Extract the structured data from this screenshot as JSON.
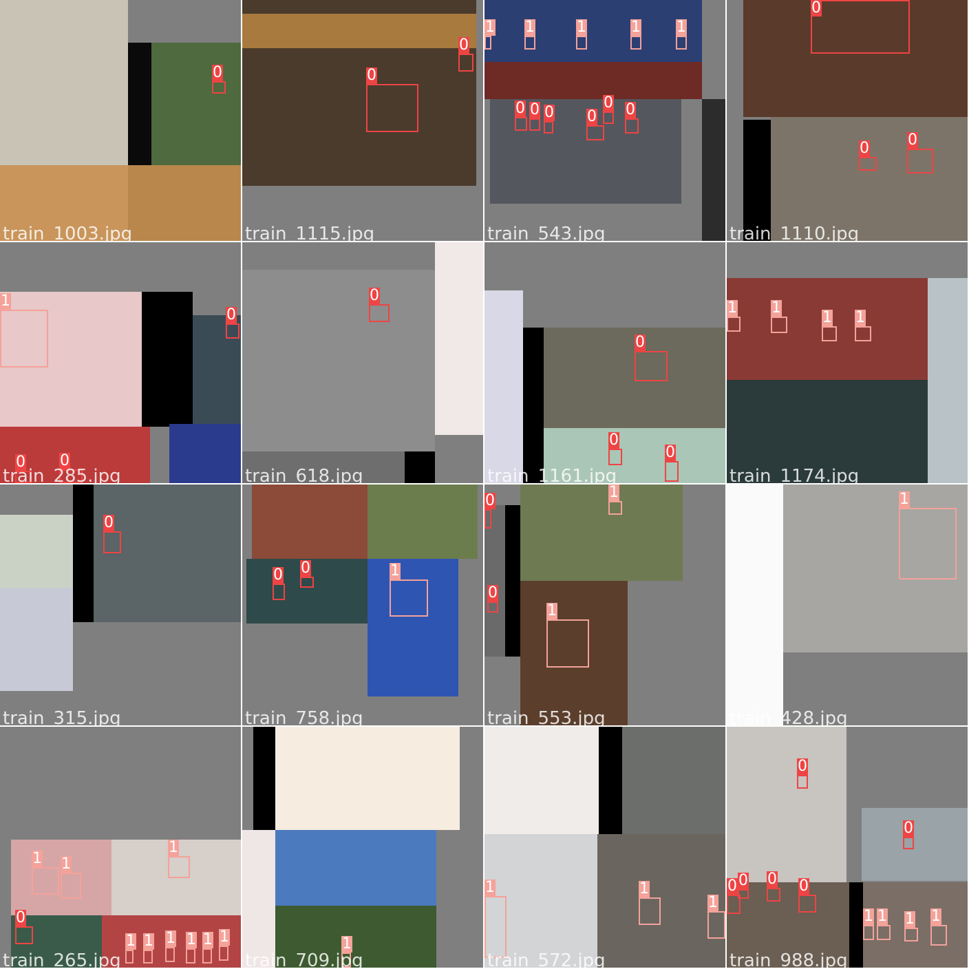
{
  "colors": {
    "class_0": "#ee4444",
    "class_1": "#f4a29a",
    "background": "#7f7f7f",
    "separator": "#ffffff"
  },
  "tiles": [
    {
      "filename": "train_1003.jpg",
      "photos": [
        {
          "r": [
            0,
            0,
            186,
            240
          ],
          "c": "#c9c3b6"
        },
        {
          "r": [
            186,
            62,
            164,
            180
          ],
          "c": "#0a0a0a"
        },
        {
          "r": [
            220,
            62,
            130,
            178
          ],
          "c": "#4e6a3e"
        },
        {
          "r": [
            0,
            240,
            186,
            110
          ],
          "c": "#c9955a"
        },
        {
          "r": [
            186,
            240,
            164,
            110
          ],
          "c": "#b9874c"
        }
      ],
      "boxes": [
        {
          "r": [
            308,
            118,
            20,
            18
          ],
          "cls": "0"
        }
      ]
    },
    {
      "filename": "train_1115.jpg",
      "photos": [
        {
          "r": [
            0,
            0,
            340,
            270
          ],
          "c": "#4a3b2c"
        },
        {
          "r": [
            0,
            20,
            340,
            50
          ],
          "c": "#a97a3e"
        }
      ],
      "boxes": [
        {
          "r": [
            180,
            122,
            76,
            70
          ],
          "cls": "0"
        },
        {
          "r": [
            314,
            78,
            22,
            26
          ],
          "cls": "0"
        }
      ]
    },
    {
      "filename": "train_543.jpg",
      "photos": [
        {
          "r": [
            0,
            0,
            316,
            144
          ],
          "c": "#2c3f73"
        },
        {
          "r": [
            0,
            90,
            316,
            54
          ],
          "c": "#6e2a25"
        },
        {
          "r": [
            8,
            144,
            278,
            152
          ],
          "c": "#55575e"
        },
        {
          "r": [
            316,
            144,
            34,
            206
          ],
          "c": "#2c2c2c"
        }
      ],
      "boxes": [
        {
          "r": [
            0,
            52,
            10,
            20
          ],
          "cls": "1"
        },
        {
          "r": [
            58,
            52,
            16,
            20
          ],
          "cls": "1"
        },
        {
          "r": [
            133,
            52,
            16,
            20
          ],
          "cls": "1"
        },
        {
          "r": [
            212,
            52,
            16,
            20
          ],
          "cls": "1"
        },
        {
          "r": [
            278,
            52,
            16,
            20
          ],
          "cls": "1"
        },
        {
          "r": [
            44,
            170,
            18,
            20
          ],
          "cls": "0"
        },
        {
          "r": [
            65,
            172,
            16,
            18
          ],
          "cls": "0"
        },
        {
          "r": [
            86,
            176,
            14,
            18
          ],
          "cls": "0"
        },
        {
          "r": [
            148,
            182,
            26,
            22
          ],
          "cls": "0"
        },
        {
          "r": [
            172,
            162,
            16,
            18
          ],
          "cls": "0"
        },
        {
          "r": [
            204,
            172,
            20,
            22
          ],
          "cls": "0"
        }
      ]
    },
    {
      "filename": "train_1110.jpg",
      "photos": [
        {
          "r": [
            24,
            0,
            326,
            170
          ],
          "c": "#5a3a2a"
        },
        {
          "r": [
            64,
            170,
            286,
            180
          ],
          "c": "#7c7468"
        },
        {
          "r": [
            24,
            174,
            40,
            176
          ],
          "c": "#000000"
        }
      ],
      "boxes": [
        {
          "r": [
            122,
            0,
            144,
            78
          ],
          "cls": "0"
        },
        {
          "r": [
            192,
            228,
            26,
            20
          ],
          "cls": "0"
        },
        {
          "r": [
            262,
            216,
            38,
            36
          ],
          "cls": "0"
        }
      ]
    },
    {
      "filename": "train_285.jpg",
      "photos": [
        {
          "r": [
            0,
            72,
            206,
            196
          ],
          "c": "#e8c8c8"
        },
        {
          "r": [
            206,
            72,
            74,
            196
          ],
          "c": "#000000"
        },
        {
          "r": [
            280,
            106,
            70,
            164
          ],
          "c": "#3b4b56"
        },
        {
          "r": [
            0,
            268,
            218,
            82
          ],
          "c": "#bb3a3a"
        },
        {
          "r": [
            246,
            264,
            104,
            86
          ],
          "c": "#2a3b8e"
        }
      ],
      "boxes": [
        {
          "r": [
            0,
            98,
            70,
            84
          ],
          "cls": "1"
        },
        {
          "r": [
            328,
            118,
            20,
            22
          ],
          "cls": "0"
        },
        {
          "r": [
            22,
            332,
            24,
            18
          ],
          "cls": "0"
        },
        {
          "r": [
            86,
            330,
            34,
            20
          ],
          "cls": "0"
        }
      ]
    },
    {
      "filename": "train_618.jpg",
      "photos": [
        {
          "r": [
            0,
            40,
            280,
            264
          ],
          "c": "#8d8d8d"
        },
        {
          "r": [
            280,
            0,
            70,
            280
          ],
          "c": "#f1e8e8"
        },
        {
          "r": [
            0,
            304,
            280,
            46
          ],
          "c": "#6e6e6e"
        },
        {
          "r": [
            236,
            304,
            44,
            46
          ],
          "c": "#000000"
        }
      ],
      "boxes": [
        {
          "r": [
            184,
            90,
            30,
            26
          ],
          "cls": "0"
        }
      ]
    },
    {
      "filename": "train_1161.jpg",
      "photos": [
        {
          "r": [
            0,
            70,
            56,
            280
          ],
          "c": "#d8d8e6"
        },
        {
          "r": [
            56,
            124,
            30,
            226
          ],
          "c": "#000000"
        },
        {
          "r": [
            86,
            124,
            264,
            146
          ],
          "c": "#6c6a5c"
        },
        {
          "r": [
            86,
            270,
            264,
            80
          ],
          "c": "#aac6b6"
        }
      ],
      "boxes": [
        {
          "r": [
            218,
            158,
            48,
            44
          ],
          "cls": "0"
        },
        {
          "r": [
            180,
            300,
            20,
            24
          ],
          "cls": "0"
        },
        {
          "r": [
            262,
            318,
            20,
            30
          ],
          "cls": "0"
        }
      ]
    },
    {
      "filename": "train_1174.jpg",
      "photos": [
        {
          "r": [
            0,
            52,
            350,
            298
          ],
          "c": "#8a3a35"
        },
        {
          "r": [
            0,
            200,
            350,
            150
          ],
          "c": "#2b3a3b"
        },
        {
          "r": [
            292,
            52,
            58,
            298
          ],
          "c": "#b9c2c6"
        }
      ],
      "boxes": [
        {
          "r": [
            0,
            108,
            20,
            22
          ],
          "cls": "1"
        },
        {
          "r": [
            64,
            108,
            24,
            24
          ],
          "cls": "1"
        },
        {
          "r": [
            138,
            122,
            22,
            22
          ],
          "cls": "1"
        },
        {
          "r": [
            186,
            122,
            24,
            22
          ],
          "cls": "1"
        }
      ]
    },
    {
      "filename": "train_315.jpg",
      "photos": [
        {
          "r": [
            0,
            44,
            106,
            256
          ],
          "c": "#c9d2c4"
        },
        {
          "r": [
            106,
            0,
            30,
            200
          ],
          "c": "#000000"
        },
        {
          "r": [
            136,
            0,
            214,
            200
          ],
          "c": "#5b6466"
        },
        {
          "r": [
            0,
            150,
            106,
            150
          ],
          "c": "#c7c9d6"
        }
      ],
      "boxes": [
        {
          "r": [
            150,
            68,
            26,
            32
          ],
          "cls": "0"
        }
      ]
    },
    {
      "filename": "train_758.jpg",
      "photos": [
        {
          "r": [
            14,
            0,
            168,
            108
          ],
          "c": "#8c4a38"
        },
        {
          "r": [
            182,
            0,
            160,
            108
          ],
          "c": "#6b7d4c"
        },
        {
          "r": [
            6,
            108,
            176,
            94
          ],
          "c": "#2f4a4a"
        },
        {
          "r": [
            182,
            108,
            132,
            200
          ],
          "c": "#2f55b2"
        }
      ],
      "boxes": [
        {
          "r": [
            44,
            144,
            18,
            24
          ],
          "cls": "0"
        },
        {
          "r": [
            84,
            134,
            20,
            16
          ],
          "cls": "0"
        },
        {
          "r": [
            214,
            138,
            56,
            54
          ],
          "cls": "1"
        }
      ]
    },
    {
      "filename": "train_553.jpg",
      "photos": [
        {
          "r": [
            0,
            30,
            30,
            220
          ],
          "c": "#6a6a6a"
        },
        {
          "r": [
            30,
            30,
            22,
            220
          ],
          "c": "#000000"
        },
        {
          "r": [
            52,
            0,
            236,
            140
          ],
          "c": "#6e7a52"
        },
        {
          "r": [
            52,
            140,
            156,
            210
          ],
          "c": "#5b3e2c"
        }
      ],
      "boxes": [
        {
          "r": [
            0,
            36,
            10,
            28
          ],
          "cls": "0"
        },
        {
          "r": [
            4,
            170,
            16,
            16
          ],
          "cls": "0"
        },
        {
          "r": [
            180,
            24,
            20,
            20
          ],
          "cls": "1"
        },
        {
          "r": [
            90,
            196,
            62,
            70
          ],
          "cls": "1"
        }
      ]
    },
    {
      "filename": "train_428.jpg",
      "photos": [
        {
          "r": [
            0,
            0,
            82,
            350
          ],
          "c": "#fafafa"
        },
        {
          "r": [
            82,
            0,
            268,
            244
          ],
          "c": "#a7a6a2"
        }
      ],
      "boxes": [
        {
          "r": [
            250,
            34,
            84,
            104
          ],
          "cls": "1"
        }
      ]
    },
    {
      "filename": "train_265.jpg",
      "photos": [
        {
          "r": [
            16,
            164,
            146,
            110
          ],
          "c": "#d6a6a6"
        },
        {
          "r": [
            162,
            164,
            188,
            110
          ],
          "c": "#d7cfc9"
        },
        {
          "r": [
            16,
            274,
            132,
            76
          ],
          "c": "#3a5a4a"
        },
        {
          "r": [
            148,
            274,
            202,
            76
          ],
          "c": "#b24444"
        }
      ],
      "boxes": [
        {
          "r": [
            46,
            204,
            40,
            40
          ],
          "cls": "1"
        },
        {
          "r": [
            88,
            212,
            30,
            38
          ],
          "cls": "1"
        },
        {
          "r": [
            244,
            188,
            32,
            32
          ],
          "cls": "1"
        },
        {
          "r": [
            22,
            290,
            26,
            26
          ],
          "cls": "0"
        },
        {
          "r": [
            182,
            324,
            12,
            20
          ],
          "cls": "1"
        },
        {
          "r": [
            208,
            324,
            14,
            20
          ],
          "cls": "1"
        },
        {
          "r": [
            240,
            320,
            14,
            22
          ],
          "cls": "1"
        },
        {
          "r": [
            270,
            322,
            14,
            22
          ],
          "cls": "1"
        },
        {
          "r": [
            294,
            322,
            14,
            22
          ],
          "cls": "1"
        },
        {
          "r": [
            318,
            318,
            14,
            22
          ],
          "cls": "1"
        }
      ]
    },
    {
      "filename": "train_709.jpg",
      "photos": [
        {
          "r": [
            16,
            0,
            32,
            150
          ],
          "c": "#000000"
        },
        {
          "r": [
            48,
            0,
            268,
            150
          ],
          "c": "#f6ecdf"
        },
        {
          "r": [
            0,
            150,
            48,
            200
          ],
          "c": "#efe6e6"
        },
        {
          "r": [
            48,
            150,
            234,
            200
          ],
          "c": "#4b7abf"
        },
        {
          "r": [
            48,
            260,
            234,
            90
          ],
          "c": "#3d5a30"
        }
      ],
      "boxes": [
        {
          "r": [
            144,
            328,
            14,
            22
          ],
          "cls": "1"
        }
      ]
    },
    {
      "filename": "train_572.jpg",
      "photos": [
        {
          "r": [
            0,
            0,
            166,
            156
          ],
          "c": "#f0ecea"
        },
        {
          "r": [
            166,
            0,
            34,
            156
          ],
          "c": "#000000"
        },
        {
          "r": [
            200,
            0,
            150,
            156
          ],
          "c": "#6b6e6b"
        },
        {
          "r": [
            0,
            156,
            164,
            194
          ],
          "c": "#d2d4d6"
        },
        {
          "r": [
            164,
            156,
            186,
            194
          ],
          "c": "#6a665f"
        }
      ],
      "boxes": [
        {
          "r": [
            0,
            246,
            32,
            90
          ],
          "cls": "1"
        },
        {
          "r": [
            224,
            248,
            32,
            40
          ],
          "cls": "1"
        },
        {
          "r": [
            324,
            268,
            26,
            40
          ],
          "cls": "1"
        }
      ]
    },
    {
      "filename": "train_988.jpg",
      "photos": [
        {
          "r": [
            0,
            0,
            174,
            226
          ],
          "c": "#c8c4c0"
        },
        {
          "r": [
            196,
            118,
            154,
            106
          ],
          "c": "#9aa3a8"
        },
        {
          "r": [
            178,
            226,
            20,
            124
          ],
          "c": "#000000"
        },
        {
          "r": [
            0,
            226,
            178,
            124
          ],
          "c": "#6b5e52"
        },
        {
          "r": [
            198,
            226,
            152,
            124
          ],
          "c": "#7a6e66"
        }
      ],
      "boxes": [
        {
          "r": [
            102,
            70,
            16,
            20
          ],
          "cls": "0"
        },
        {
          "r": [
            256,
            160,
            16,
            18
          ],
          "cls": "0"
        },
        {
          "r": [
            0,
            244,
            20,
            28
          ],
          "cls": "0"
        },
        {
          "r": [
            16,
            236,
            16,
            14
          ],
          "cls": "0"
        },
        {
          "r": [
            58,
            234,
            20,
            20
          ],
          "cls": "0"
        },
        {
          "r": [
            104,
            244,
            26,
            26
          ],
          "cls": "0"
        },
        {
          "r": [
            198,
            288,
            16,
            22
          ],
          "cls": "1"
        },
        {
          "r": [
            218,
            288,
            20,
            22
          ],
          "cls": "1"
        },
        {
          "r": [
            258,
            292,
            20,
            20
          ],
          "cls": "1"
        },
        {
          "r": [
            296,
            288,
            24,
            30
          ],
          "cls": "1"
        }
      ]
    }
  ]
}
